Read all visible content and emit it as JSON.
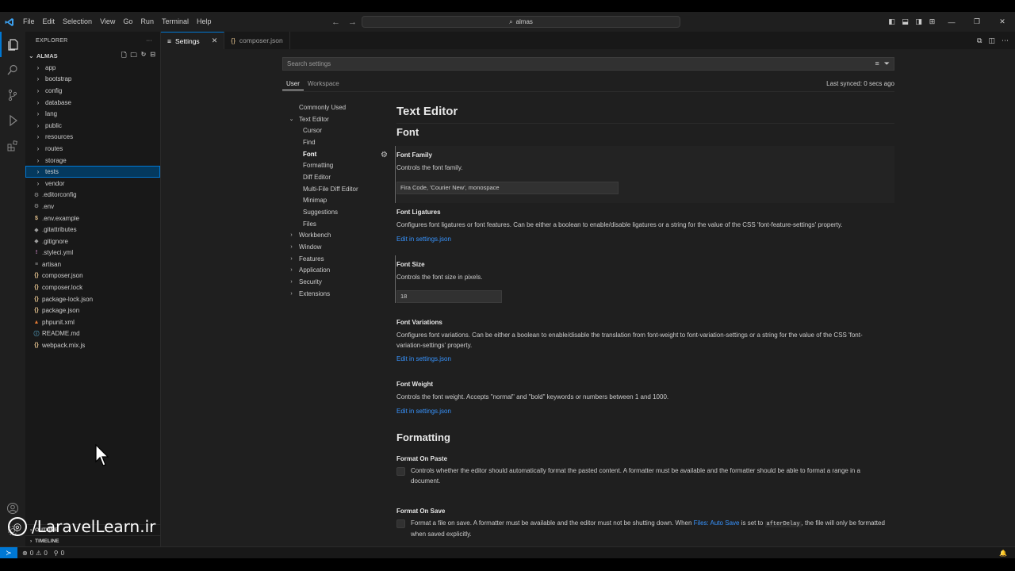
{
  "menu": [
    "File",
    "Edit",
    "Selection",
    "View",
    "Go",
    "Run",
    "Terminal",
    "Help"
  ],
  "command_center": "almas",
  "explorer": {
    "title": "EXPLORER",
    "root": "ALMAS",
    "items": [
      {
        "label": "app",
        "kind": "folder"
      },
      {
        "label": "bootstrap",
        "kind": "folder"
      },
      {
        "label": "config",
        "kind": "folder"
      },
      {
        "label": "database",
        "kind": "folder"
      },
      {
        "label": "lang",
        "kind": "folder"
      },
      {
        "label": "public",
        "kind": "folder"
      },
      {
        "label": "resources",
        "kind": "folder"
      },
      {
        "label": "routes",
        "kind": "folder"
      },
      {
        "label": "storage",
        "kind": "folder"
      },
      {
        "label": "tests",
        "kind": "folder",
        "selected": true
      },
      {
        "label": "vendor",
        "kind": "folder"
      },
      {
        "label": ".editorconfig",
        "kind": "file",
        "icon": "⚙",
        "color": "#9d9d9d"
      },
      {
        "label": ".env",
        "kind": "file",
        "icon": "⚙",
        "color": "#9d9d9d"
      },
      {
        "label": ".env.example",
        "kind": "file",
        "icon": "$",
        "color": "#e2c08d"
      },
      {
        "label": ".gitattributes",
        "kind": "file",
        "icon": "◆",
        "color": "#9d9d9d"
      },
      {
        "label": ".gitignore",
        "kind": "file",
        "icon": "◆",
        "color": "#9d9d9d"
      },
      {
        "label": ".styleci.yml",
        "kind": "file",
        "icon": "!",
        "color": "#c586c0"
      },
      {
        "label": "artisan",
        "kind": "file",
        "icon": "≡",
        "color": "#9d9d9d"
      },
      {
        "label": "composer.json",
        "kind": "file",
        "icon": "{}",
        "color": "#e2c08d"
      },
      {
        "label": "composer.lock",
        "kind": "file",
        "icon": "{}",
        "color": "#e2c08d"
      },
      {
        "label": "package-lock.json",
        "kind": "file",
        "icon": "{}",
        "color": "#e2c08d"
      },
      {
        "label": "package.json",
        "kind": "file",
        "icon": "{}",
        "color": "#e2c08d"
      },
      {
        "label": "phpunit.xml",
        "kind": "file",
        "icon": "▲",
        "color": "#e37933"
      },
      {
        "label": "README.md",
        "kind": "file",
        "icon": "ⓘ",
        "color": "#519aba"
      },
      {
        "label": "webpack.mix.js",
        "kind": "file",
        "icon": "{}",
        "color": "#e2c08d"
      }
    ],
    "outline": "OUTLINE",
    "timeline": "TIMELINE"
  },
  "tabs": [
    {
      "label": "Settings",
      "icon": "≡",
      "active": true
    },
    {
      "label": "composer.json",
      "icon": "{}",
      "active": false
    }
  ],
  "settings": {
    "search_placeholder": "Search settings",
    "scopes": [
      "User",
      "Workspace"
    ],
    "last_synced": "Last synced: 0 secs ago",
    "toc": [
      {
        "label": "Commonly Used",
        "level": "lvl0",
        "chev": ""
      },
      {
        "label": "Text Editor",
        "level": "lvl0c",
        "chev": "⌄"
      },
      {
        "label": "Cursor",
        "level": "lvl1",
        "chev": ""
      },
      {
        "label": "Find",
        "level": "lvl1",
        "chev": ""
      },
      {
        "label": "Font",
        "level": "lvl1",
        "chev": "",
        "bold": true
      },
      {
        "label": "Formatting",
        "level": "lvl1",
        "chev": ""
      },
      {
        "label": "Diff Editor",
        "level": "lvl1",
        "chev": ""
      },
      {
        "label": "Multi-File Diff Editor",
        "level": "lvl1",
        "chev": ""
      },
      {
        "label": "Minimap",
        "level": "lvl1",
        "chev": ""
      },
      {
        "label": "Suggestions",
        "level": "lvl1",
        "chev": ""
      },
      {
        "label": "Files",
        "level": "lvl1",
        "chev": ""
      },
      {
        "label": "Workbench",
        "level": "lvl0c",
        "chev": "›"
      },
      {
        "label": "Window",
        "level": "lvl0c",
        "chev": "›"
      },
      {
        "label": "Features",
        "level": "lvl0c",
        "chev": "›"
      },
      {
        "label": "Application",
        "level": "lvl0c",
        "chev": "›"
      },
      {
        "label": "Security",
        "level": "lvl0c",
        "chev": "›"
      },
      {
        "label": "Extensions",
        "level": "lvl0c",
        "chev": "›"
      }
    ],
    "section_title": "Text Editor",
    "font_heading": "Font",
    "font_family": {
      "title": "Font Family",
      "desc": "Controls the font family.",
      "value": "Fira Code, 'Courier New', monospace"
    },
    "font_ligatures": {
      "title": "Font Ligatures",
      "desc": "Configures font ligatures or font features. Can be either a boolean to enable/disable ligatures or a string for the value of the CSS 'font-feature-settings' property.",
      "link": "Edit in settings.json"
    },
    "font_size": {
      "title": "Font Size",
      "desc": "Controls the font size in pixels.",
      "value": "18"
    },
    "font_variations": {
      "title": "Font Variations",
      "desc": "Configures font variations. Can be either a boolean to enable/disable the translation from font-weight to font-variation-settings or a string for the value of the CSS 'font-variation-settings' property.",
      "link": "Edit in settings.json"
    },
    "font_weight": {
      "title": "Font Weight",
      "desc": "Controls the font weight. Accepts \"normal\" and \"bold\" keywords or numbers between 1 and 1000.",
      "link": "Edit in settings.json"
    },
    "formatting_heading": "Formatting",
    "format_on_paste": {
      "title": "Format On Paste",
      "desc": "Controls whether the editor should automatically format the pasted content. A formatter must be available and the formatter should be able to format a range in a document."
    },
    "format_on_save": {
      "title": "Format On Save",
      "desc_a": "Format a file on save. A formatter must be available and the editor must not be shutting down. When",
      "desc_link": "Files: Auto Save",
      "desc_b": "is set to",
      "desc_code": "afterDelay",
      "desc_c": ", the file will only be formatted when saved explicitly."
    }
  },
  "status": {
    "errors": "0",
    "warnings": "0",
    "ports": "0"
  },
  "watermark": "/LaravelLearn.ir"
}
